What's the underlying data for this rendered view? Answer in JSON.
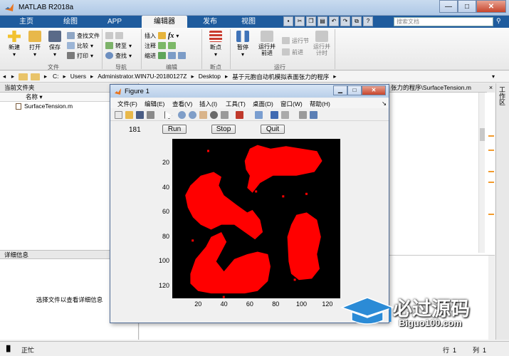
{
  "window": {
    "title": "MATLAB R2018a",
    "min": "—",
    "max": "□",
    "close": "✕"
  },
  "tabs": [
    "主页",
    "绘图",
    "APP",
    "编辑器",
    "发布",
    "视图"
  ],
  "search": {
    "placeholder": "搜索文档"
  },
  "ribbon": {
    "file": {
      "new": "新建",
      "open": "打开",
      "save": "保存",
      "find_files": "查找文件",
      "compare": "比较",
      "print": "打印",
      "group": "文件"
    },
    "navigate": {
      "goto": "转至",
      "find": "查找",
      "group": "导航"
    },
    "edit": {
      "insert": "插入",
      "comment": "注释",
      "indent": "缩进",
      "fx": "fx",
      "group": "编辑"
    },
    "breakpoints": {
      "label": "断点",
      "group": "断点"
    },
    "run": {
      "pause": "暂停",
      "run_advance": "运行并\n前进",
      "run_section": "运行节",
      "advance": "前进",
      "run_time": "运行并\n计时",
      "group": "运行"
    }
  },
  "address": {
    "path": [
      "C:",
      "Users",
      "Administrator.WIN7U-20180127Z",
      "Desktop",
      "基于元胞自动机模拟表面张力的程序"
    ]
  },
  "left_pane": {
    "header": "当前文件夹",
    "column": "名称",
    "files": [
      "SurfaceTension.m"
    ],
    "details_header": "详细信息",
    "details_message": "选择文件以查看详细信息"
  },
  "editor": {
    "tab_title": "张力的程序\\SurfaceTension.m"
  },
  "workspace": {
    "label": "工作区"
  },
  "status": {
    "text": "正忙",
    "row_label": "行",
    "row": "1",
    "col_label": "列",
    "col": "1"
  },
  "figure": {
    "title": "Figure 1",
    "menu": [
      "文件(F)",
      "编辑(E)",
      "查看(V)",
      "插入(I)",
      "工具(T)",
      "桌面(D)",
      "窗口(W)",
      "帮助(H)"
    ],
    "counter": "181",
    "buttons": {
      "run": "Run",
      "stop": "Stop",
      "quit": "Quit"
    }
  },
  "chart_data": {
    "type": "heatmap",
    "title": "",
    "xlabel": "",
    "ylabel": "",
    "xlim": [
      0,
      130
    ],
    "ylim": [
      130,
      0
    ],
    "xticks": [
      20,
      40,
      60,
      80,
      100,
      120
    ],
    "yticks": [
      20,
      40,
      60,
      80,
      100,
      120
    ],
    "colors": {
      "background": "#000000",
      "filled": "#ff0000"
    },
    "regions": [
      {
        "name": "top-right blob",
        "x": [
          56,
          116
        ],
        "y": [
          5,
          48
        ]
      },
      {
        "name": "left-upper blob",
        "x": [
          10,
          70
        ],
        "y": [
          27,
          82
        ]
      },
      {
        "name": "bottom-left blob",
        "x": [
          14,
          76
        ],
        "y": [
          62,
          127
        ]
      },
      {
        "name": "right-lower blob",
        "x": [
          89,
          115
        ],
        "y": [
          60,
          115
        ]
      }
    ]
  },
  "watermark": {
    "main": "必过源码",
    "sub": "Biguo100.com"
  }
}
